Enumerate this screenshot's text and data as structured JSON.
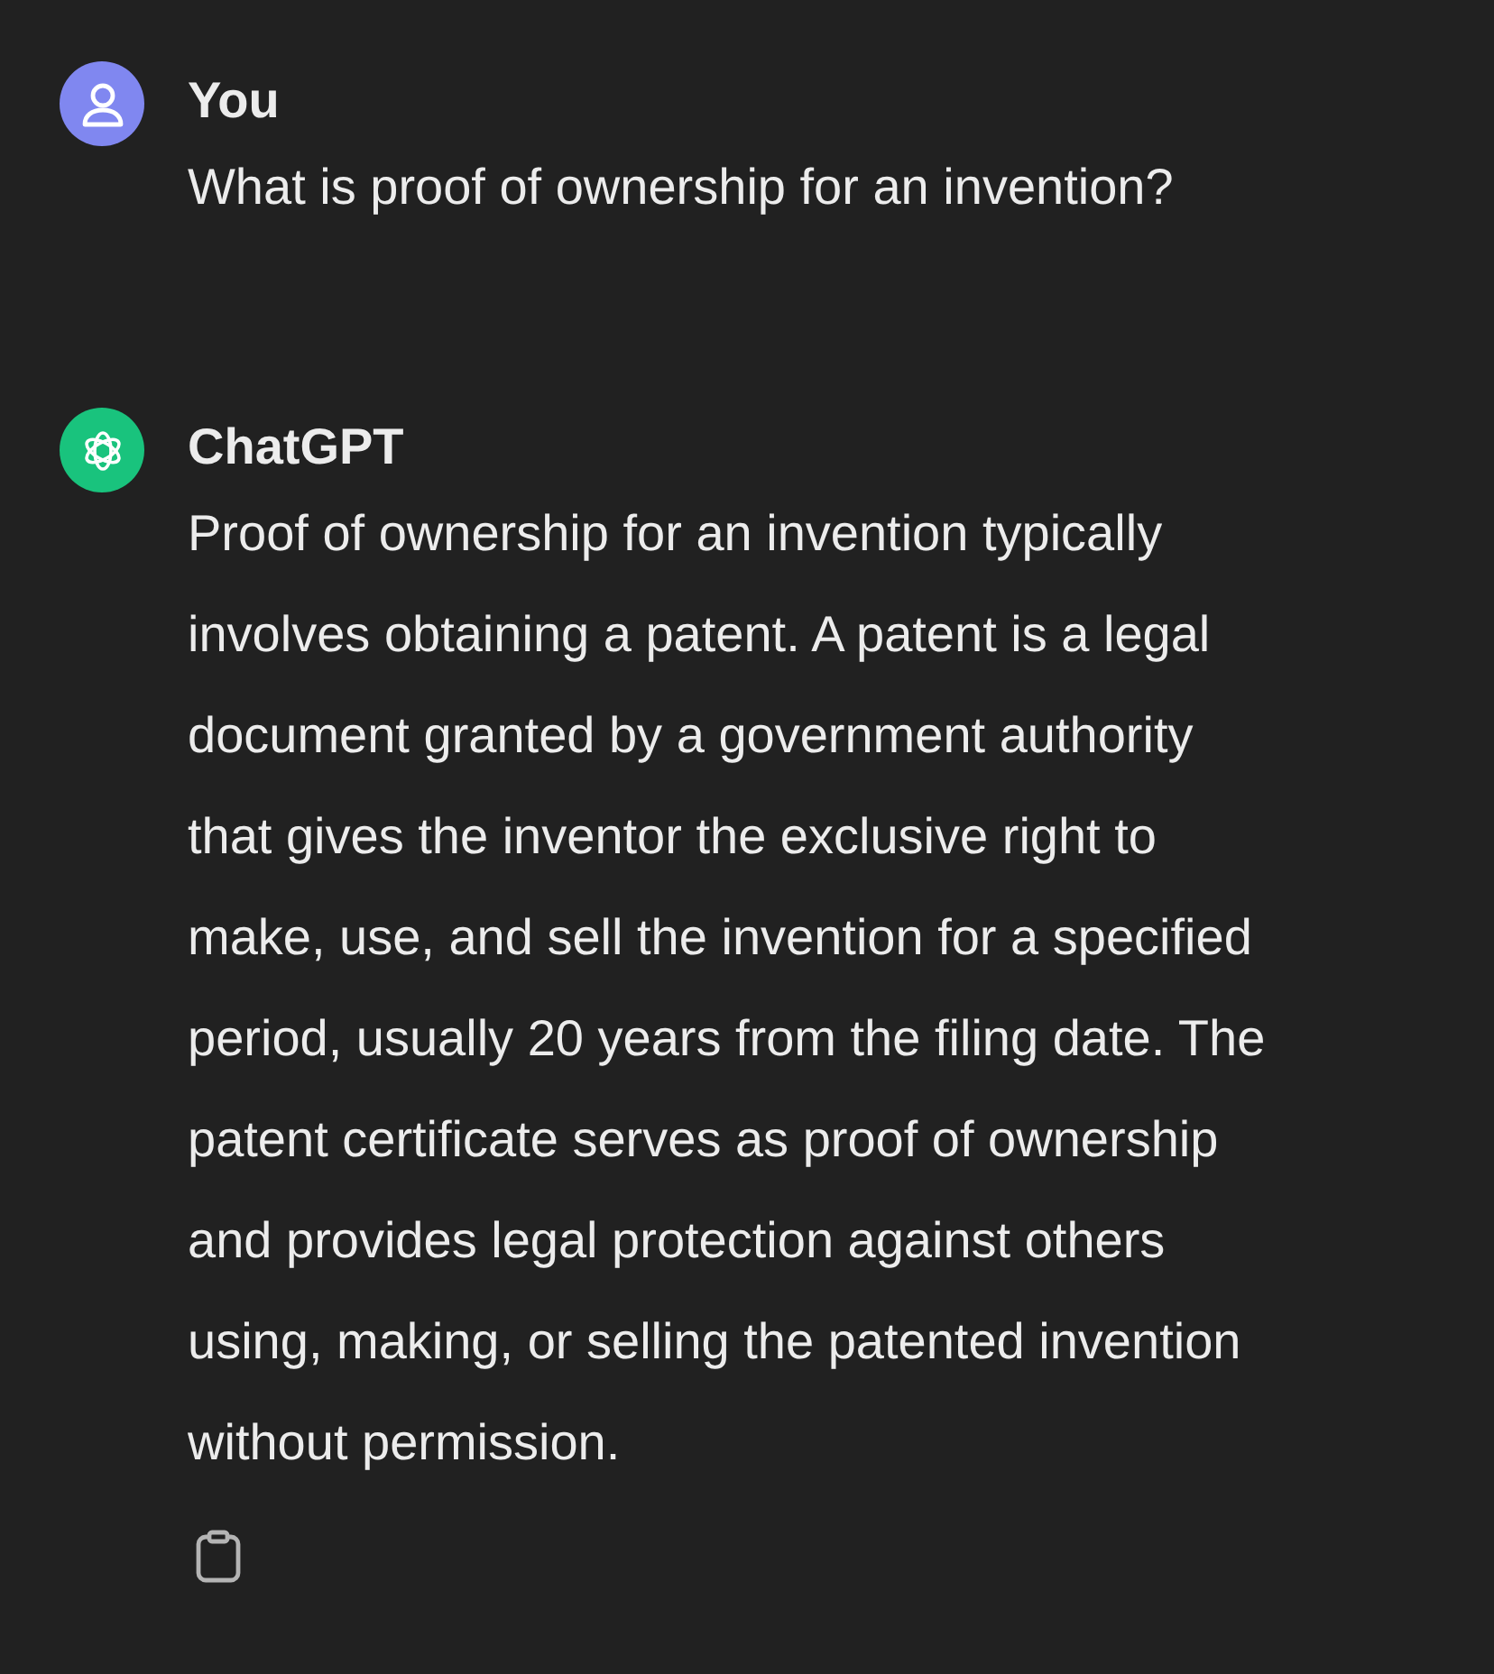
{
  "messages": [
    {
      "kind": "user",
      "author": "You",
      "text": "What is proof of ownership for an invention?"
    },
    {
      "kind": "assistant",
      "author": "ChatGPT",
      "text": "Proof of ownership for an invention typically involves obtaining a patent. A patent is a legal document granted by a government authority that gives the inventor the exclusive right to make, use, and sell the invention for a specified period, usually 20 years from the filing date. The patent certificate serves as proof of ownership and provides legal protection against others using, making, or selling the patented invention without permission.",
      "copy_action": true
    }
  ]
}
